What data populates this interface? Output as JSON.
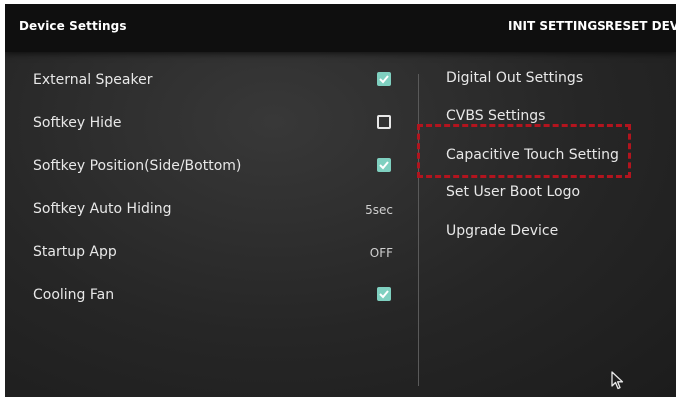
{
  "header": {
    "title": "Device Settings",
    "init_settings": "INIT SETTINGS",
    "reset_device": "RESET DEVICE"
  },
  "left_settings": [
    {
      "label": "External Speaker",
      "control": "checkbox",
      "checked": true
    },
    {
      "label": "Softkey Hide",
      "control": "checkbox",
      "checked": false
    },
    {
      "label": "Softkey Position(Side/Bottom)",
      "control": "checkbox",
      "checked": true
    },
    {
      "label": "Softkey Auto Hiding",
      "control": "value",
      "value": "5sec"
    },
    {
      "label": "Startup App",
      "control": "value",
      "value": "OFF"
    },
    {
      "label": "Cooling Fan",
      "control": "checkbox",
      "checked": true
    }
  ],
  "right_menu": [
    {
      "label": "Digital Out Settings"
    },
    {
      "label": "CVBS Settings"
    },
    {
      "label": "Capacitive Touch Setting",
      "highlighted": true
    },
    {
      "label": "Set User Boot Logo"
    },
    {
      "label": "Upgrade Device"
    }
  ],
  "colors": {
    "checkbox_on": "#7fd0c0",
    "highlight_border": "#b3141e",
    "topbar": "#0f0f0f"
  },
  "icons": {
    "checkmark": "check-icon",
    "cursor": "mouse-pointer-icon"
  }
}
